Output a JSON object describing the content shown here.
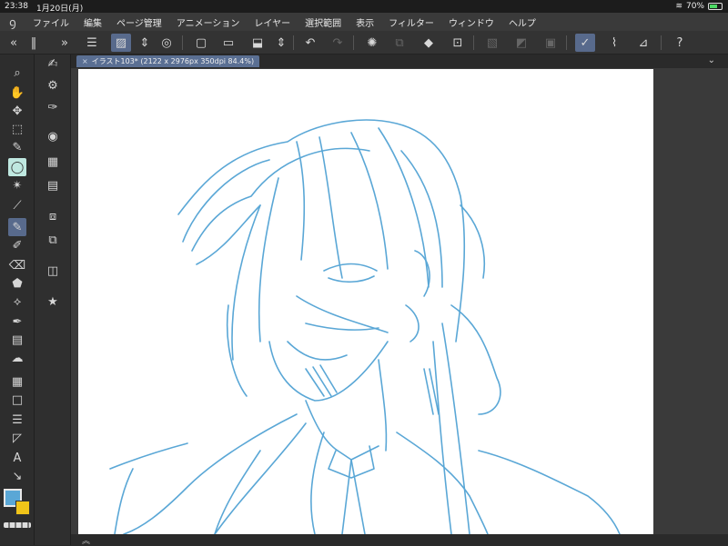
{
  "status": {
    "time": "23:38",
    "date": "1月20日(月)",
    "battery": "70%",
    "battery_level": 0.7
  },
  "menu": {
    "items": [
      "ファイル",
      "編集",
      "ページ管理",
      "アニメーション",
      "レイヤー",
      "選択範囲",
      "表示",
      "フィルター",
      "ウィンドウ",
      "ヘルプ"
    ]
  },
  "toolbar": {
    "icons": [
      "menu-icon",
      "canvas-icon",
      "up-down-icon",
      "trash-icon",
      "new-file-icon",
      "open-folder-icon",
      "save-icon",
      "up-down-icon",
      "undo-icon",
      "redo-icon",
      "selection-icon",
      "copy-icon",
      "fill-icon",
      "crop-icon",
      "hide-icon",
      "transparent-icon",
      "frame-icon",
      "pen-icon",
      "brush-icon",
      "ruler-icon",
      "help-icon"
    ]
  },
  "document": {
    "tab_label": "イラスト103* (2122 x 2976px 350dpi 84.4%)"
  },
  "colors": {
    "main": "#5aa7d6",
    "sub": "#f0c419",
    "sketch": "#5aa7d6"
  }
}
